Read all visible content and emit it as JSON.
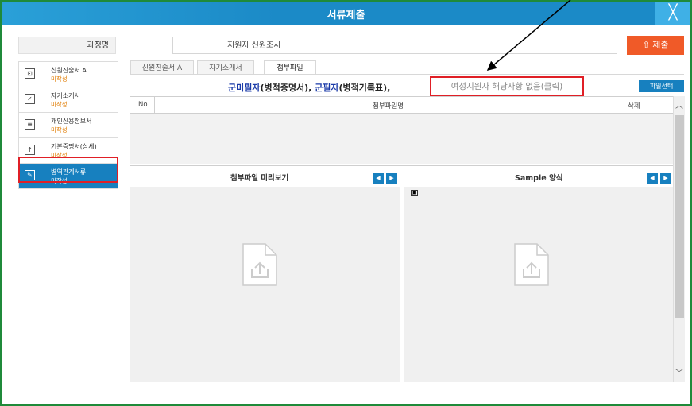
{
  "window": {
    "title": "서류제출",
    "close_glyph": "╳"
  },
  "course": {
    "label": "과정명",
    "value": "지원자 신원조사"
  },
  "submit": {
    "label": "⇧ 제출"
  },
  "sidebar": {
    "items": [
      {
        "name": "신원진술서 A",
        "status": "미작성",
        "icon": "doc-seal-icon",
        "glyph": "⊡"
      },
      {
        "name": "자기소개서",
        "status": "미작성",
        "icon": "check-box-icon",
        "glyph": "✓"
      },
      {
        "name": "개인신용정보서",
        "status": "미작성",
        "icon": "list-doc-icon",
        "glyph": "≡"
      },
      {
        "name": "기본증명서(상세)",
        "status": "미작성",
        "icon": "upload-box-icon",
        "glyph": "↑"
      },
      {
        "name": "병역관계서류",
        "status": "미작성",
        "icon": "edit-icon",
        "glyph": "✎"
      }
    ]
  },
  "tabs": [
    "신원진술서 A",
    "자기소개서",
    "첨부파일"
  ],
  "notice": {
    "part1": "군미필자",
    "part2": "(병적증명서), ",
    "part3": "군필자",
    "part4": "(병적기록표),"
  },
  "female_button": "여성지원자 해당사항 없음(클릭)",
  "file_select": "파일선택",
  "table": {
    "col_no": "No",
    "col_name": "첨부파일명",
    "col_delete": "삭제"
  },
  "preview": {
    "left_title": "첨부파일 미리보기",
    "right_title": "Sample 양식",
    "prev": "◀",
    "next": "▶"
  },
  "colors": {
    "accent": "#1780bf",
    "submit": "#f05a28",
    "highlight": "#e01f26",
    "status": "#e07b00"
  }
}
